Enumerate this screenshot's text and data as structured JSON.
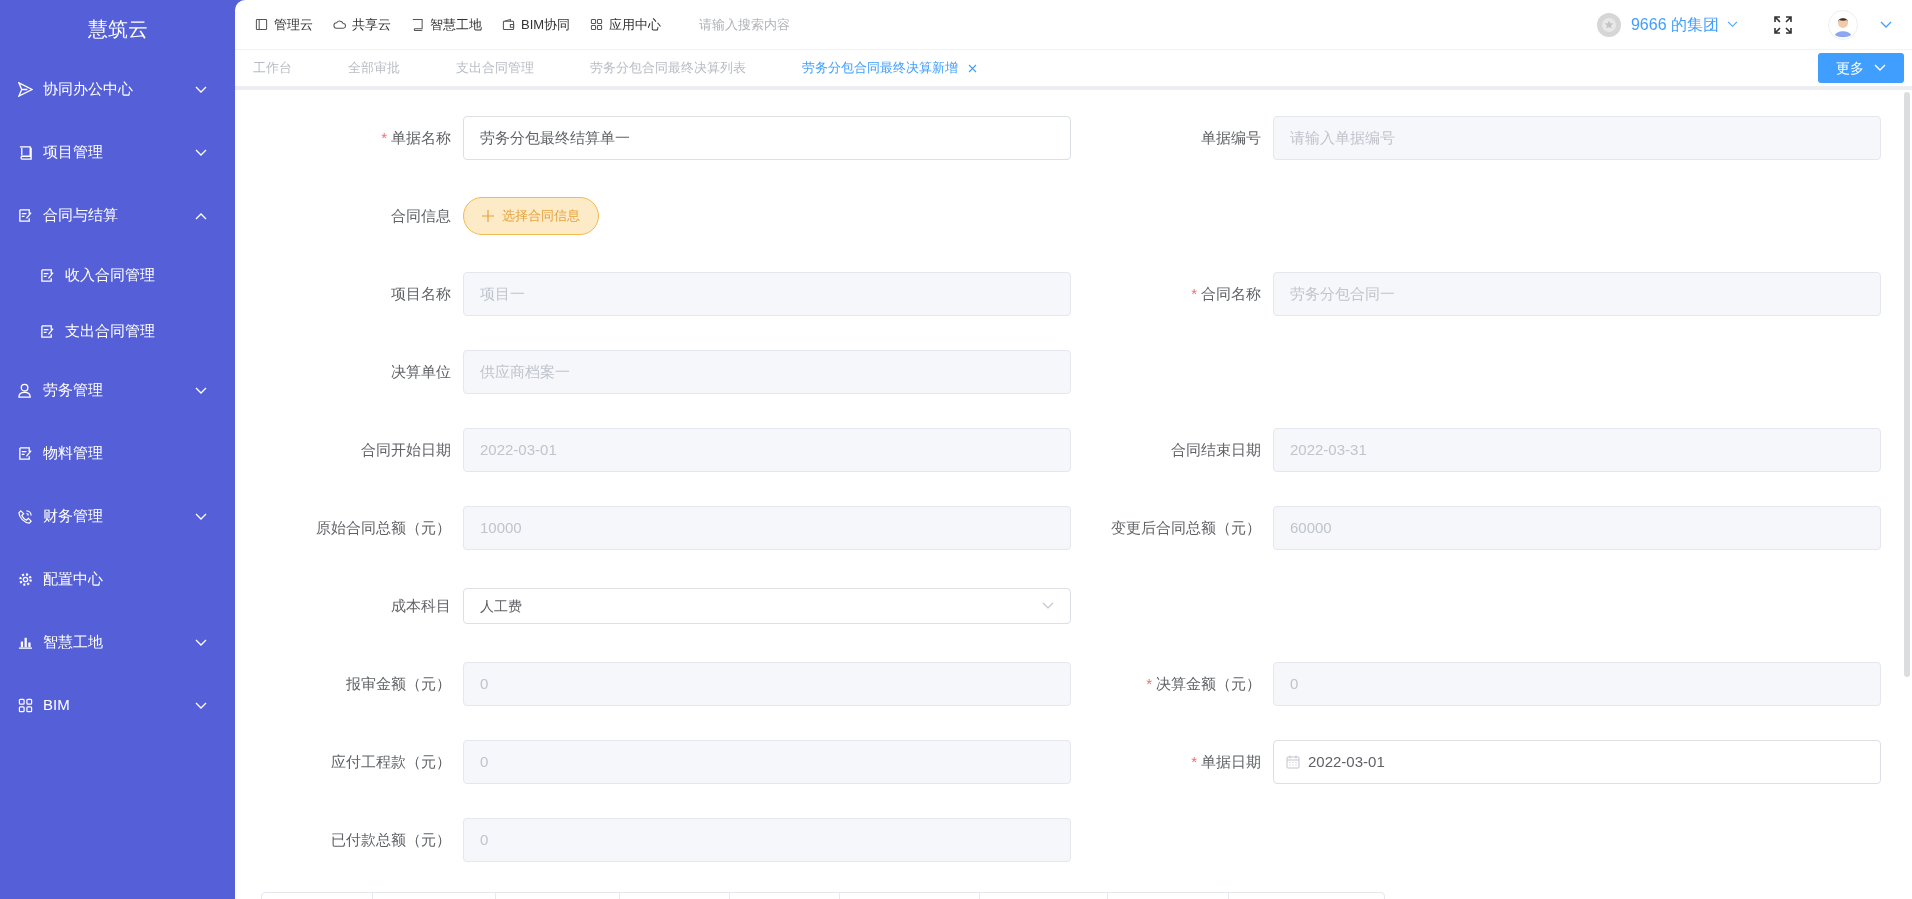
{
  "sidebar": {
    "logo": "慧筑云",
    "items": [
      {
        "label": "协同办公中心",
        "expanded": false
      },
      {
        "label": "项目管理",
        "expanded": false
      },
      {
        "label": "合同与结算",
        "expanded": true,
        "children": [
          {
            "label": "收入合同管理"
          },
          {
            "label": "支出合同管理"
          }
        ]
      },
      {
        "label": "劳务管理",
        "expanded": false
      },
      {
        "label": "物料管理"
      },
      {
        "label": "财务管理",
        "expanded": false
      },
      {
        "label": "配置中心"
      },
      {
        "label": "智慧工地",
        "expanded": false
      },
      {
        "label": "BIM",
        "expanded": false
      }
    ]
  },
  "top_nav": {
    "links": [
      "管理云",
      "共享云",
      "智慧工地",
      "BIM协同",
      "应用中心"
    ],
    "search": {
      "placeholder": "请输入搜索内容"
    },
    "org": "9666 的集团"
  },
  "tabs": [
    {
      "label": "工作台",
      "selected": false
    },
    {
      "label": "全部审批",
      "selected": false
    },
    {
      "label": "支出合同管理",
      "selected": false
    },
    {
      "label": "劳务分包合同最终决算列表",
      "selected": false
    },
    {
      "label": "劳务分包合同最终决算新增",
      "selected": true
    }
  ],
  "more_button": "更多",
  "form": {
    "rows": [
      [
        {
          "asterisk": "*",
          "label": "单据名称",
          "kind": "text",
          "value": "劳务分包最终结算单一"
        },
        {
          "label": "单据编号",
          "kind": "disabled",
          "placeholder": "请输入单据编号"
        }
      ],
      [
        {
          "label": "合同信息",
          "kind": "button",
          "value": "选择合同信息"
        }
      ],
      [
        {
          "label": "项目名称",
          "kind": "disabled",
          "value": "项目一"
        },
        {
          "asterisk": "*",
          "label": "合同名称",
          "kind": "disabled",
          "value": "劳务分包合同一"
        }
      ],
      [
        {
          "label": "决算单位",
          "kind": "disabled",
          "value": "供应商档案一"
        }
      ],
      [
        {
          "label": "合同开始日期",
          "kind": "disabled",
          "value": "2022-03-01"
        },
        {
          "label": "合同结束日期",
          "kind": "disabled",
          "value": "2022-03-31"
        }
      ],
      [
        {
          "label": "原始合同总额（元）",
          "kind": "disabled",
          "value": "10000"
        },
        {
          "label": "变更后合同总额（元）",
          "kind": "disabled",
          "value": "60000"
        }
      ],
      [
        {
          "label": "成本科目",
          "kind": "select",
          "value": "人工费"
        }
      ],
      [
        {
          "label": "报审金额（元）",
          "kind": "disabled",
          "value": "0"
        },
        {
          "asterisk": "*",
          "label": "决算金额（元）",
          "kind": "disabled",
          "value": "0"
        }
      ],
      [
        {
          "label": "应付工程款（元）",
          "kind": "disabled",
          "value": "0"
        },
        {
          "asterisk": "*",
          "label": "单据日期",
          "kind": "date",
          "value": "2022-03-01"
        }
      ],
      [
        {
          "label": "已付款总额（元）",
          "kind": "disabled",
          "value": "0"
        }
      ]
    ]
  }
}
